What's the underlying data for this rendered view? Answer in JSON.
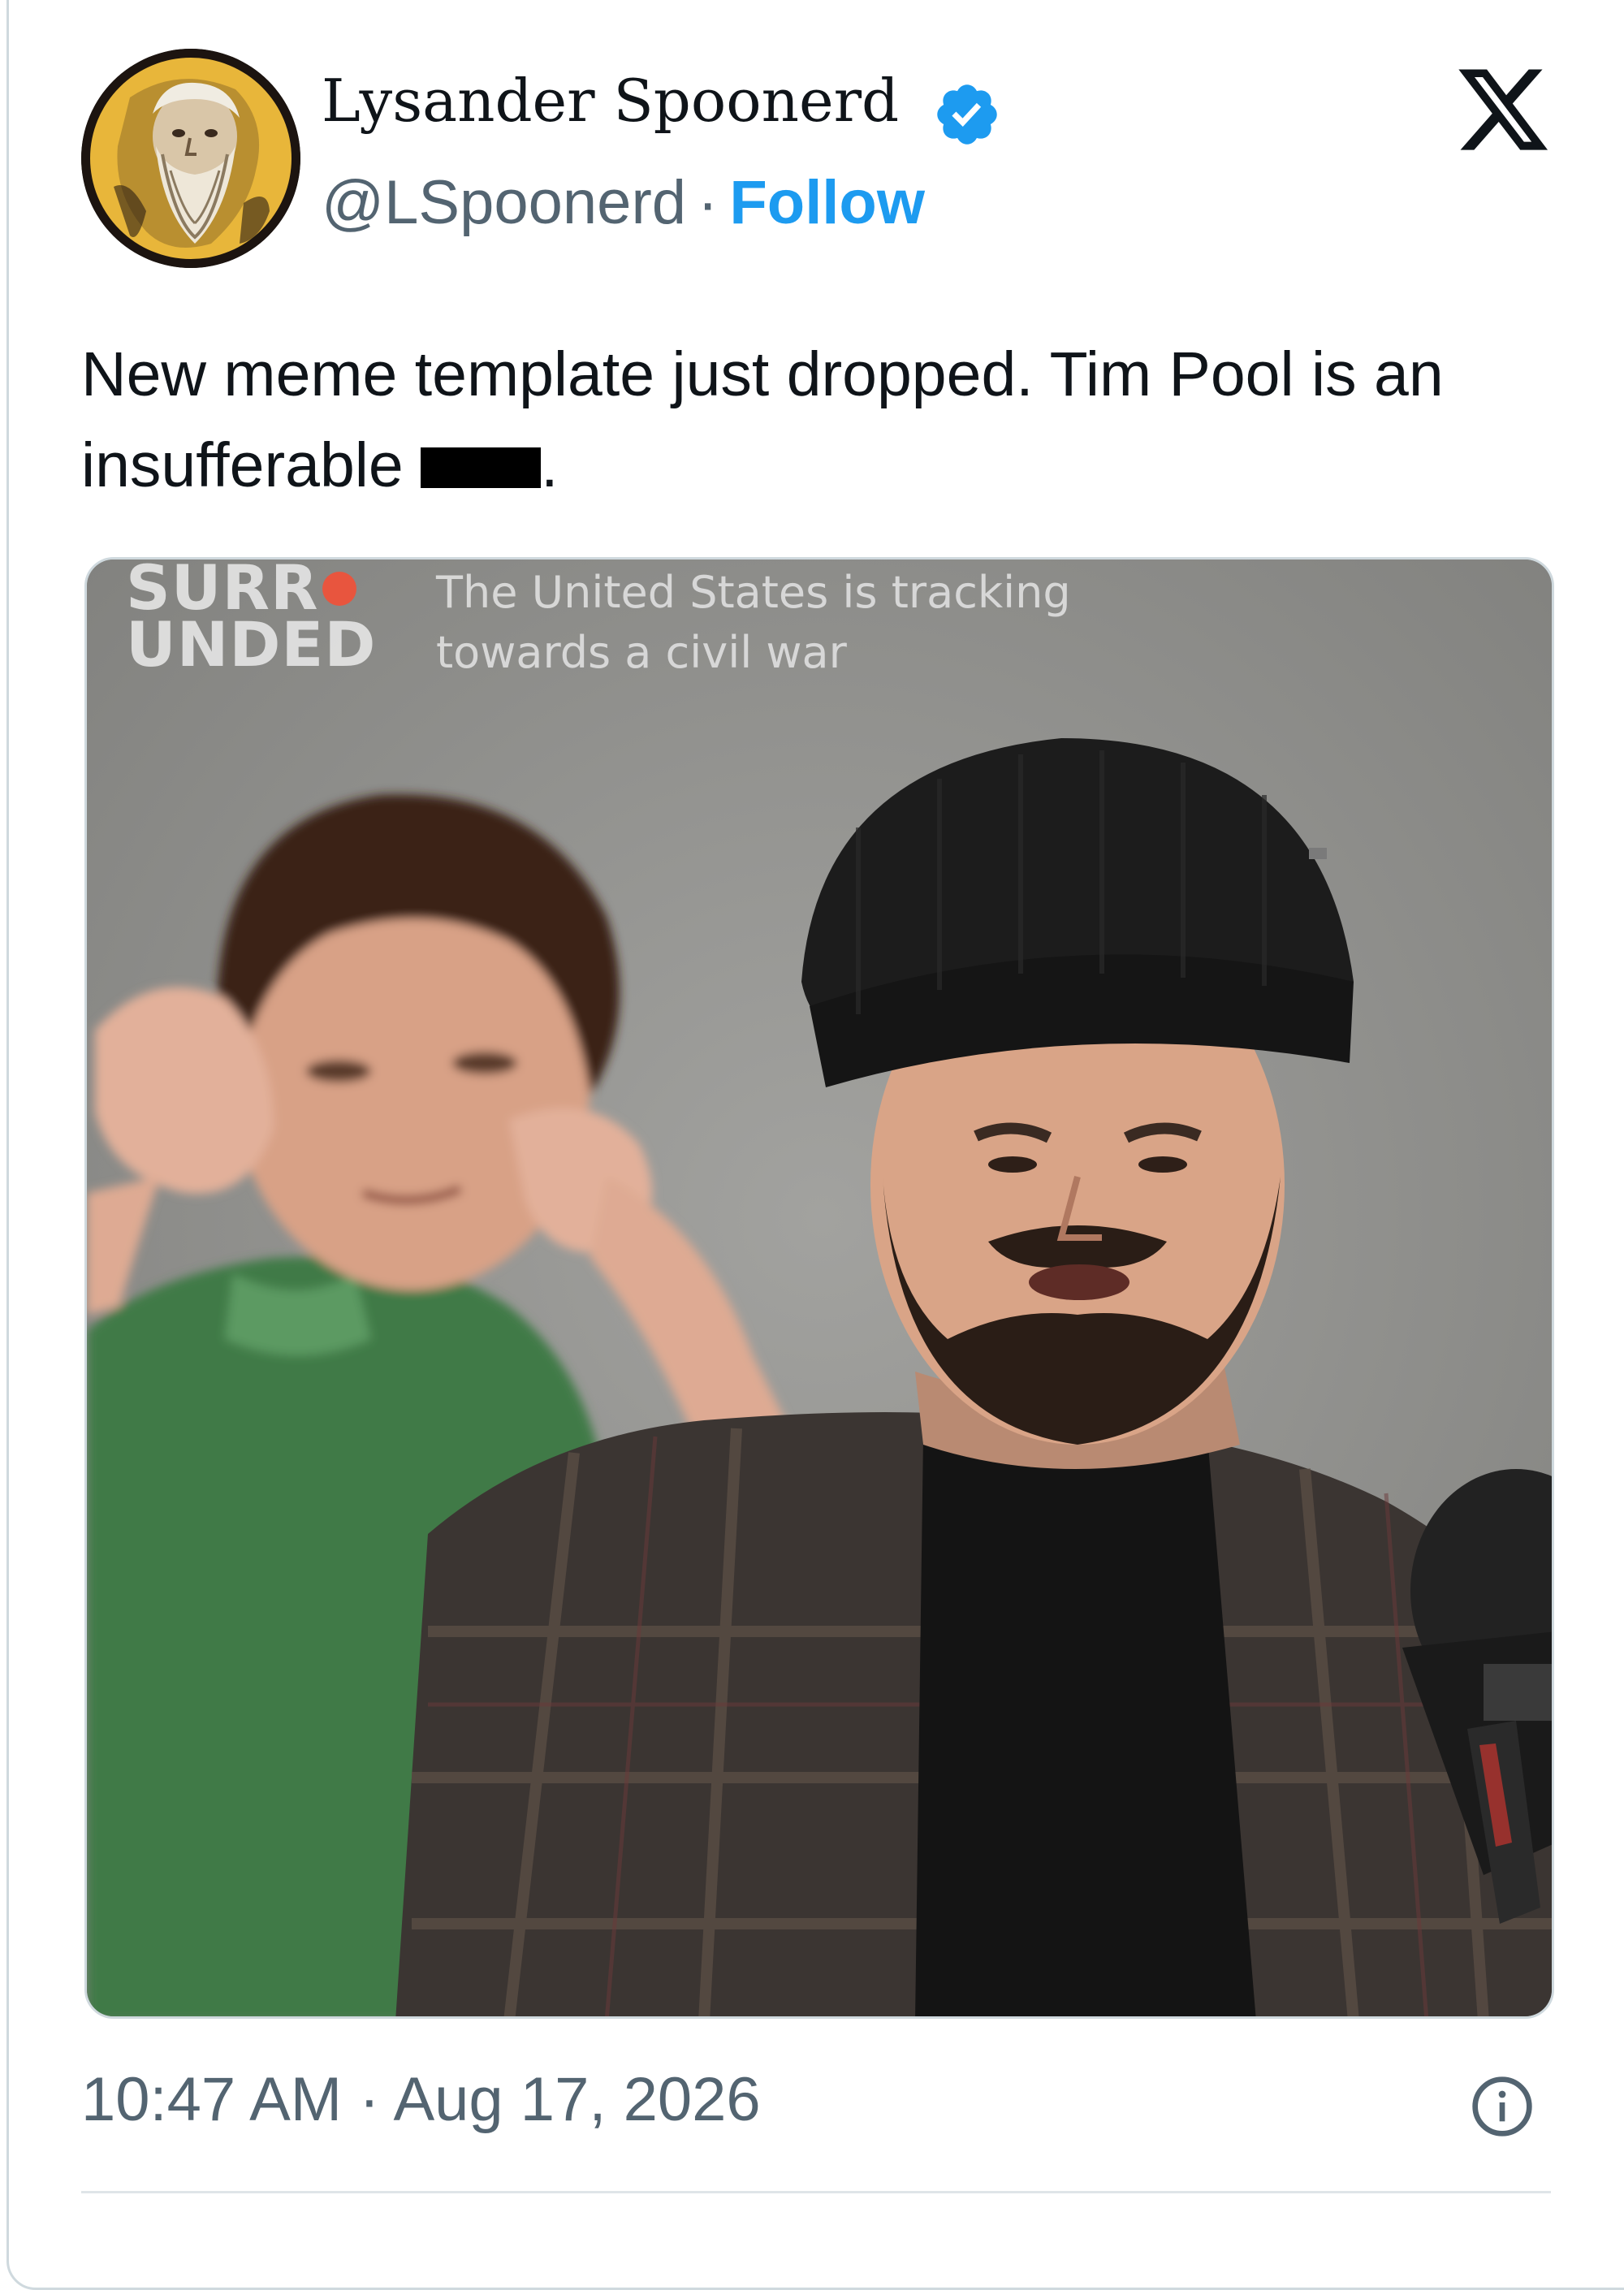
{
  "author": {
    "display_name": "Lysander Spoonerd",
    "handle": "@LSpoonerd",
    "separator": "·",
    "follow_label": "Follow",
    "verified": true,
    "avatar_icon": "bearded-man-portrait-avatar"
  },
  "platform_logo": "x-logo-icon",
  "tweet": {
    "text_before": "New meme template just dropped. Tim Pool is an insufferable ",
    "text_after": "."
  },
  "media": {
    "overlay_brand_line1": "SURR",
    "overlay_brand_line2": "UNDED",
    "overlay_caption": "The United States is tracking towards a civil war"
  },
  "meta": {
    "time": "10:47 AM",
    "separator": "·",
    "date": "Aug 17, 2026"
  },
  "colors": {
    "text": "#0f1419",
    "secondary": "#536471",
    "accent": "#1d9bf0",
    "border": "#cfd9de"
  }
}
